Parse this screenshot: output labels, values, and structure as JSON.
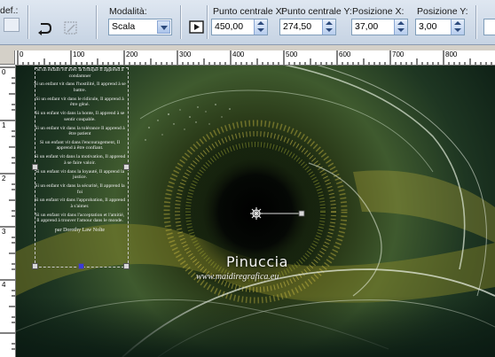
{
  "toolbar": {
    "preset_label": "def.:",
    "mode_label": "Modalità:",
    "mode_value": "Scala",
    "center_x_label": "Punto centrale X:",
    "center_x_value": "450,00",
    "center_y_label": "Punto centrale Y:",
    "center_y_value": "274,50",
    "pos_x_label": "Posizione X:",
    "pos_x_value": "37,00",
    "pos_y_label": "Posizione Y:",
    "pos_y_value": "3,00"
  },
  "ruler": {
    "h_labels": [
      "0",
      "100",
      "200",
      "300",
      "400",
      "500",
      "600",
      "700",
      "800"
    ],
    "v_labels": [
      "0",
      "1",
      "2",
      "3",
      "4"
    ]
  },
  "poem": {
    "lines": [
      "Si un enfant vit avec la critique Il apprend à condamner",
      "Si un enfant vit dans l'hostilité, Il apprend à se battre.",
      "Si un enfant vit dans le ridicule, Il apprend à être gêné.",
      "Si un enfant vit dans la honte, Il apprend à se sentir coupable.",
      "Si un enfant vit dans la tolérance Il apprend à être patient",
      "Si un enfant vit dans l'encouragement, Il apprend à être confiant.",
      "Si un enfant vit dans la motivation, Il apprend à se faire valoir.",
      "Si un enfant vit dans la loyauté, Il apprend la justice.",
      "Si un enfant vit dans la sécurité, Il apprend la foi",
      "Si un enfant vit dans l'approbation, Il apprend à s'aimer.",
      "Si un enfant vit dans l'acceptation et l'amitié, Il apprend à trouver l'amour dans le monde."
    ],
    "signature": "par Dorothy Law Nolte"
  },
  "watermark": {
    "name": "Pinuccia",
    "url": "www.maidiregrafica.eu"
  },
  "colors": {
    "toolbar_bg": "#c6d3e3",
    "canvas_bg": "#0d1a10",
    "accent_gold": "#c9b23a"
  }
}
